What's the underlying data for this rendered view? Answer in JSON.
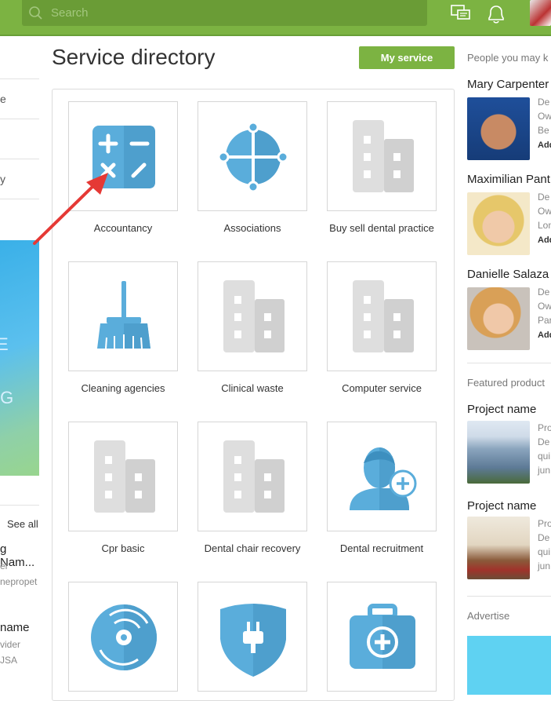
{
  "topbar": {
    "search_placeholder": "Search",
    "icons": [
      "search-icon",
      "messages-icon",
      "bell-icon",
      "avatar"
    ],
    "color": "#7cb342"
  },
  "left_fragments": {
    "items": [
      "e",
      "",
      "y"
    ],
    "banner_text": [
      "E",
      "IG"
    ],
    "see_all": "See all",
    "entry1": [
      "g Nam...",
      "er",
      "nepropet"
    ],
    "entry2": [
      "name",
      "vider",
      "JSA"
    ]
  },
  "main": {
    "title": "Service directory",
    "my_service_label": "My service",
    "services": [
      {
        "label": "Accountancy",
        "icon": "calculator-icon"
      },
      {
        "label": "Associations",
        "icon": "network-icon"
      },
      {
        "label": "Buy sell dental practice",
        "icon": "building-icon"
      },
      {
        "label": "Cleaning agencies",
        "icon": "broom-icon"
      },
      {
        "label": "Clinical waste",
        "icon": "building-icon"
      },
      {
        "label": "Computer service",
        "icon": "building-icon"
      },
      {
        "label": "Cpr basic",
        "icon": "building-icon"
      },
      {
        "label": "Dental chair recovery",
        "icon": "building-icon"
      },
      {
        "label": "Dental recruitment",
        "icon": "person-add-icon"
      },
      {
        "label": "",
        "icon": "disc-icon"
      },
      {
        "label": "",
        "icon": "shield-plug-icon"
      },
      {
        "label": "",
        "icon": "medical-kit-icon"
      }
    ],
    "accent": "#5aaddb"
  },
  "right": {
    "people_header": "People you may k",
    "people": [
      {
        "name": "Mary Carpenter",
        "lines": [
          "De",
          "Ow",
          "Be"
        ],
        "add": "Add"
      },
      {
        "name": "Maximilian Pant",
        "lines": [
          "De",
          "Ow",
          "Lon"
        ],
        "add": "Add"
      },
      {
        "name": "Danielle Salaza",
        "lines": [
          "De",
          "Ow",
          "Par"
        ],
        "add": "Add"
      }
    ],
    "featured_header": "Featured product",
    "products": [
      {
        "name": "Project name",
        "lines": [
          "Pro",
          "De",
          "qui",
          "jun"
        ]
      },
      {
        "name": "Project name",
        "lines": [
          "Pro",
          "De",
          "qui",
          "jun"
        ]
      }
    ],
    "advertise_header": "Advertise"
  }
}
